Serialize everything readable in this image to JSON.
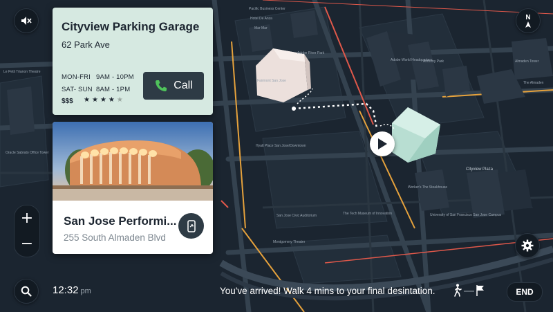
{
  "map": {
    "labels": [
      "Pacific Business Center",
      "Mar Mar",
      "Adobe World Headquarters",
      "Anthony Park",
      "Almaden Tower",
      "The Almaden",
      "Hyatt Place San Jose/Downtown",
      "Cityview Plaza",
      "The Tech Museum of Innovation",
      "Montgomery Theater",
      "San Jose Civic Auditorium",
      "University of San Francisco San Jose Campus",
      "Worker's The Steakhouse",
      "Oracle Sabrato Office Tower",
      "Le Petit Trianon Theatre",
      "Adobe River Park",
      "Hotel De Anza",
      "Fairmont San Jose"
    ]
  },
  "parking": {
    "title": "Cityview Parking Garage",
    "address": "62 Park Ave",
    "hours": [
      {
        "days": "MON-FRI",
        "time": "9AM - 10PM"
      },
      {
        "days": "SAT- SUN",
        "time": "8AM - 1PM"
      }
    ],
    "price": "$$$",
    "rating": 4,
    "rating_max": 5,
    "call_label": "Call"
  },
  "venue": {
    "title": "San Jose Performi...",
    "address": "255 South Almaden Blvd"
  },
  "status": {
    "time": "12:32",
    "ampm": "pm",
    "message": "You've arrived! Walk 4 mins to your final desintation.",
    "end_label": "END"
  },
  "compass": {
    "label": "N"
  },
  "zoom": {
    "in_label": "+",
    "out_label": "−"
  },
  "colors": {
    "map_bg": "#1b2530",
    "card_mint": "#d6e9e1",
    "accent_green": "#4fc35b",
    "route_orange": "#e6a23c",
    "route_red": "#e0584a"
  },
  "icons": [
    "mute-icon",
    "compass-icon",
    "settings-icon",
    "search-icon",
    "phone-icon",
    "transfer-phone-icon",
    "walk-icon",
    "flag-icon",
    "navigation-arrow-icon"
  ]
}
